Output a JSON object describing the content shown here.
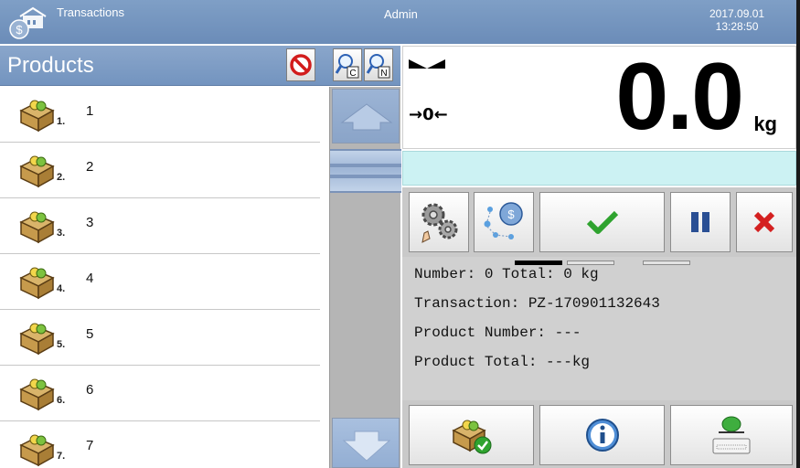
{
  "topbar": {
    "title": "Transactions",
    "user": "Admin",
    "date": "2017.09.01",
    "time": "13:28:50"
  },
  "products": {
    "title": "Products",
    "items": [
      {
        "index": "1.",
        "name": "1"
      },
      {
        "index": "2.",
        "name": "2"
      },
      {
        "index": "3.",
        "name": "3"
      },
      {
        "index": "4.",
        "name": "4"
      },
      {
        "index": "5.",
        "name": "5"
      },
      {
        "index": "6.",
        "name": "6"
      },
      {
        "index": "7.",
        "name": "7"
      }
    ]
  },
  "scale": {
    "zero_indicator": "→0←",
    "value": "0.0",
    "unit": "kg"
  },
  "details": {
    "number_line": "Number: 0 Total: 0 kg",
    "transaction_line": "Transaction: PZ-170901132643",
    "product_number_line": "Product Number: ---",
    "product_total_line": "Product Total: ---kg"
  },
  "icons": {
    "app": "scale-money-icon",
    "clear_filter": "no-entry-icon",
    "search_code": "search-c-icon",
    "search_name": "search-n-icon",
    "product": "product-box-icon",
    "settings": "gears-icon",
    "connection": "network-coin-icon",
    "accept": "checkmark-icon",
    "pause": "pause-icon",
    "cancel": "x-icon",
    "product_accept": "box-check-icon",
    "info": "info-icon",
    "print": "printer-icon"
  },
  "colors": {
    "header_blue": "#7394bf",
    "accent_green": "#2fa32f",
    "cancel_red": "#d42020",
    "pause_blue": "#2a4f94",
    "info_bar": "#ccf2f3"
  }
}
